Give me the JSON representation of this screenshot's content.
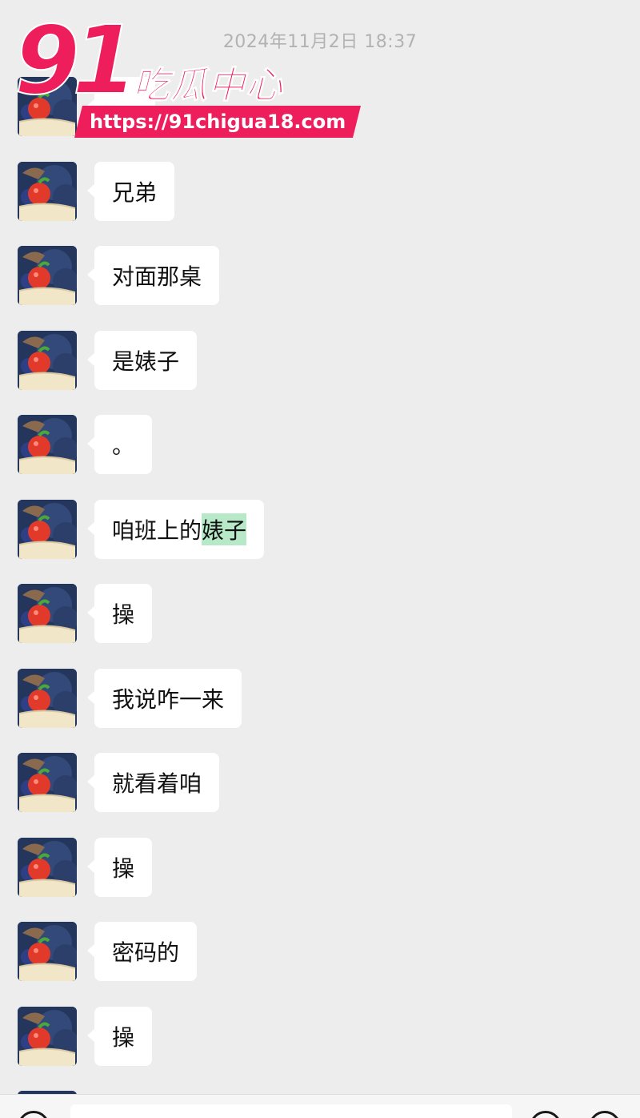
{
  "timestamp": "2024年11月2日 18:37",
  "watermark": {
    "number": "91",
    "title": "吃瓜中心",
    "url": "https://91chigua18.com",
    "brand_color": "#ee1d5c"
  },
  "messages": [
    {
      "text": ""
    },
    {
      "text": "兄弟"
    },
    {
      "text": "对面那桌"
    },
    {
      "text": "是婊子"
    },
    {
      "text": "。"
    },
    {
      "text": "咱班上的",
      "highlight": "婊子"
    },
    {
      "text": "操"
    },
    {
      "text": "我说咋一来"
    },
    {
      "text": "就看着咱"
    },
    {
      "text": "操"
    },
    {
      "text": "密码的"
    },
    {
      "text": "操"
    }
  ],
  "colors": {
    "background": "#ededed",
    "bubble": "#ffffff",
    "highlight": "#b7e8c8",
    "timestamp": "#b2b2b2"
  }
}
